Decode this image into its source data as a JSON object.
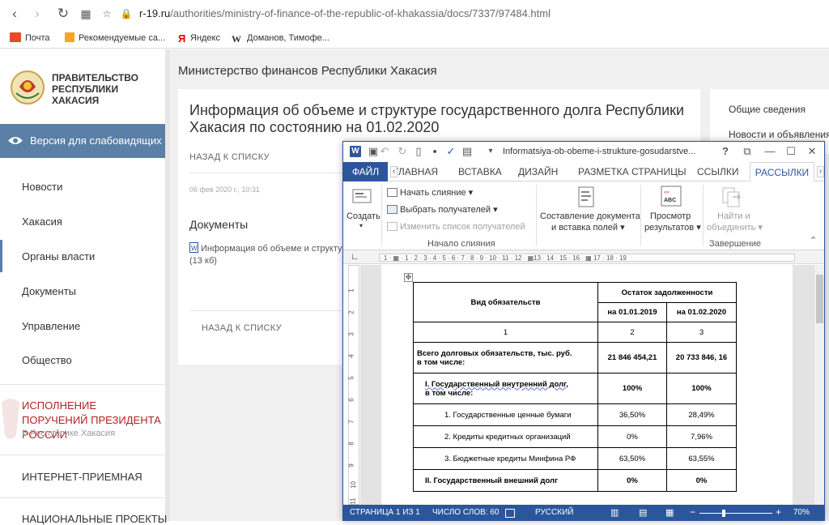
{
  "browser": {
    "url_host": "r-19.ru",
    "url_path": "/authorities/ministry-of-finance-of-the-republic-of-khakassia/docs/7337/97484.html",
    "bookmarks": [
      "Почта",
      "Рекомендуемые са...",
      "Яндекс",
      "Доманов, Тимофе..."
    ]
  },
  "site": {
    "logo_text": "ПРАВИТЕЛЬСТВО РЕСПУБЛИКИ ХАКАСИЯ",
    "accessible_version": "Версия для слабовидящих",
    "nav": [
      "Новости",
      "Хакасия",
      "Органы власти",
      "Документы",
      "Управление",
      "Общество"
    ],
    "president_block": "ИСПОЛНЕНИЕ ПОРУЧЕНИЙ ПРЕЗИДЕНТА РОССИИ",
    "president_sub": "В Республике Хакасия",
    "internet_reception": "ИНТЕРНЕТ-ПРИЕМНАЯ",
    "national_projects": "НАЦИОНАЛЬНЫЕ ПРОЕКТЫ",
    "ministry": "Министерство финансов Республики Хакасия",
    "doc_title": "Информация об объеме и структуре государственного долга Республики Хакасия по состоянию на 01.02.2020",
    "back_label": "НАЗАД К СПИСКУ",
    "date": "06 фев 2020 г., 10:31",
    "documents_heading": "Документы",
    "doc_link": "Информация об объеме и структу",
    "doc_size": "(13 кб)",
    "right_menu": [
      "Общие сведения",
      "Новости и объявления"
    ]
  },
  "word": {
    "title": "Informatsiya-ob-obeme-i-strukture-gosudarstve...",
    "title_buttons": [
      "?",
      "⧉",
      "—",
      "☐",
      "✕"
    ],
    "tabs": {
      "file": "ФАЙЛ",
      "home": "ГЛАВНАЯ",
      "insert": "ВСТАВКА",
      "design": "ДИЗАЙН",
      "layout": "РАЗМЕТКА СТРАНИЦЫ",
      "references": "ССЫЛКИ",
      "mailings": "РАССЫЛКИ"
    },
    "ribbon": {
      "create": "Создать",
      "start_merge": "Начать слияние",
      "select_recipients": "Выбрать получателей",
      "edit_recipients": "Изменить список получателей",
      "group_start": "Начало слияния",
      "compose_1": "Составление документа",
      "compose_2": "и вставка полей",
      "preview_1": "Просмотр",
      "preview_2": "результатов",
      "finish_1": "Найти и",
      "finish_2": "объединить",
      "group_finish": "Завершение"
    },
    "ruler_text": "· 1 · ▦ · 1 · 2 · 3 · 4 · 5 · 6 · 7 · 8 · 9 · 10 · 11 · 12 · ▦13 · 14 · 15 · 16 · ▦ 17 · 18 · 19",
    "vruler": [
      "1",
      "2",
      "3",
      "4",
      "5",
      "6",
      "7",
      "8",
      "9",
      "10",
      "11"
    ],
    "status": {
      "page": "СТРАНИЦА 1 ИЗ 1",
      "words": "ЧИСЛО СЛОВ: 60",
      "lang": "РУССКИЙ",
      "zoom": "70%",
      "zoom_level": 0.7
    },
    "table": {
      "h_kind": "Вид обязательств",
      "h_balance": "Остаток задолженности",
      "h_date1": "на 01.01.2019",
      "h_date2": "на 01.02.2020",
      "num_row": [
        "1",
        "2",
        "3"
      ],
      "rows": [
        {
          "label_1": "Всего долговых обязательств, тыс. руб.",
          "label_2": "в том числе:",
          "v1": "21 846 454,21",
          "v2": "20 733 846, 16"
        },
        {
          "label_1": "I. Государственный внутренний долг,",
          "label_2": "в том числе:",
          "v1": "100%",
          "v2": "100%"
        },
        {
          "label_1": "1. Государственные ценные бумаги",
          "v1": "36,50%",
          "v2": "28,49%"
        },
        {
          "label_1": "2. Кредиты кредитных организаций",
          "v1": "0%",
          "v2": "7,96%"
        },
        {
          "label_1": "3. Бюджетные кредиты Минфина РФ",
          "v1": "63,50%",
          "v2": "63,55%"
        },
        {
          "label_1": "II. Государственный внешний долг",
          "v1": "0%",
          "v2": "0%"
        }
      ]
    }
  }
}
